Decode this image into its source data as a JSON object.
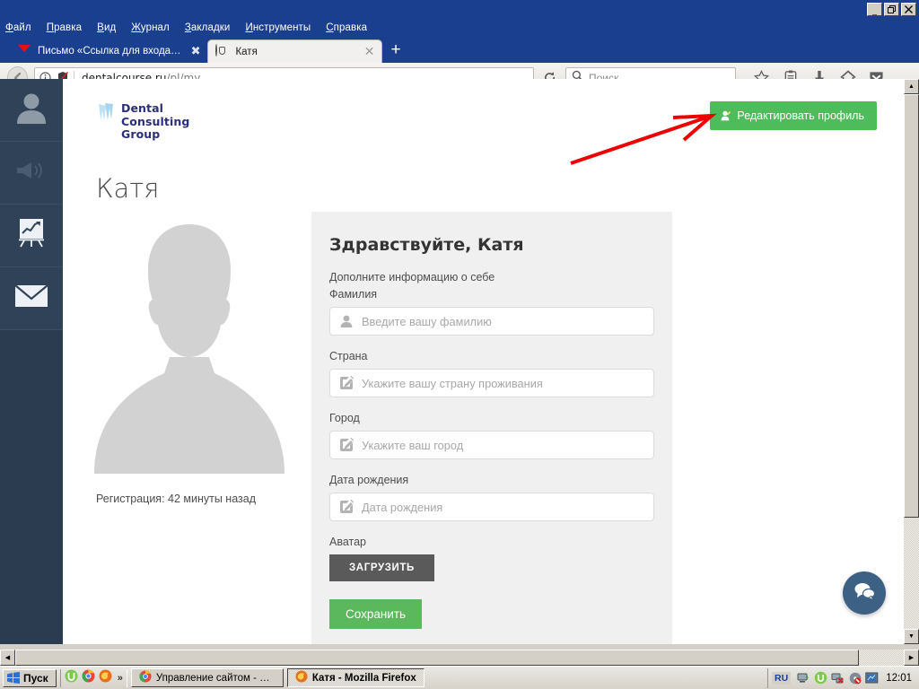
{
  "window": {
    "minimize_label": "_",
    "restore_label": "❐",
    "close_label": "✕"
  },
  "menubar": {
    "items": [
      {
        "label": "Файл",
        "accel": "Ф"
      },
      {
        "label": "Правка",
        "accel": "П"
      },
      {
        "label": "Вид",
        "accel": "В"
      },
      {
        "label": "Журнал",
        "accel": "Ж"
      },
      {
        "label": "Закладки",
        "accel": "З"
      },
      {
        "label": "Инструменты",
        "accel": "И"
      },
      {
        "label": "Справка",
        "accel": "С"
      }
    ]
  },
  "tabs": {
    "items": [
      {
        "title": "Письмо «Ссылка для входа…",
        "favicon": "yandex-mail-icon",
        "active": false,
        "close_label": "✖"
      },
      {
        "title": "Катя",
        "favicon": "firefox-page-icon",
        "active": true,
        "close_label": "✕"
      }
    ],
    "new_tab_label": "+"
  },
  "navbar": {
    "back_label": "←",
    "identity_icon": "info-circle-icon",
    "tracking_icon": "shield-crossed-icon",
    "url_host": "dentalcourse.ru",
    "url_path": "/pl/my",
    "reload_label": "↻",
    "search_placeholder": "Поиск",
    "search_icon": "search-icon",
    "icons": [
      "star-icon",
      "reader-list-icon",
      "download-arrow-icon",
      "home-icon",
      "pocket-icon",
      "hamburger-menu-icon"
    ]
  },
  "sidebar": {
    "items": [
      {
        "name": "profile",
        "icon": "user-icon",
        "active": true
      },
      {
        "name": "announcements",
        "icon": "megaphone-icon",
        "active": false
      },
      {
        "name": "statistics",
        "icon": "chart-presentation-icon",
        "active": false
      },
      {
        "name": "messages",
        "icon": "envelope-icon",
        "active": false
      }
    ]
  },
  "page": {
    "logo": {
      "line1": "Dental",
      "line2": "Consulting",
      "line3": "Group",
      "mark": "tooth-icon"
    },
    "edit_profile_button": {
      "label": "Редактировать профиль",
      "icon": "user-edit-icon",
      "color": "#4fbc5c"
    },
    "profile_name": "Катя",
    "avatar_placeholder_icon": "person-silhouette-icon",
    "registration_text": "Регистрация: 42 минуты назад",
    "form": {
      "title": "Здравствуйте, Катя",
      "subtitle": "Дополните информацию о себе",
      "fields": [
        {
          "label": "Фамилия",
          "placeholder": "Введите вашу фамилию",
          "value": "",
          "icon": "user-icon"
        },
        {
          "label": "Страна",
          "placeholder": "Укажите вашу страну проживания",
          "value": "",
          "icon": "pencil-square-icon"
        },
        {
          "label": "Город",
          "placeholder": "Укажите ваш город",
          "value": "",
          "icon": "pencil-square-icon"
        },
        {
          "label": "Дата рождения",
          "placeholder": "Дата рождения",
          "value": "",
          "icon": "pencil-square-icon"
        }
      ],
      "avatar_label": "Аватар",
      "upload_button": "ЗАГРУЗИТЬ",
      "save_button": "Сохранить"
    },
    "chat_widget_icon": "chat-bubbles-icon",
    "annotation": "red-arrow-pointing-to-edit-profile-button"
  },
  "taskbar": {
    "start_label": "Пуск",
    "quicklaunch": [
      {
        "name": "utorrent-icon"
      },
      {
        "name": "chrome-icon"
      },
      {
        "name": "firefox-icon"
      }
    ],
    "quicklaunch_more": "»",
    "items": [
      {
        "label": "Управление сайтом - G…",
        "icon": "chrome-icon",
        "active": false
      },
      {
        "label": "Катя - Mozilla Firefox",
        "icon": "firefox-icon",
        "active": true
      }
    ],
    "tray": {
      "language": "RU",
      "icons": [
        "network-icon",
        "utorrent-icon",
        "network-disconnected-icon",
        "disc-icon",
        "monitor-icon"
      ],
      "clock": "12:01"
    }
  }
}
